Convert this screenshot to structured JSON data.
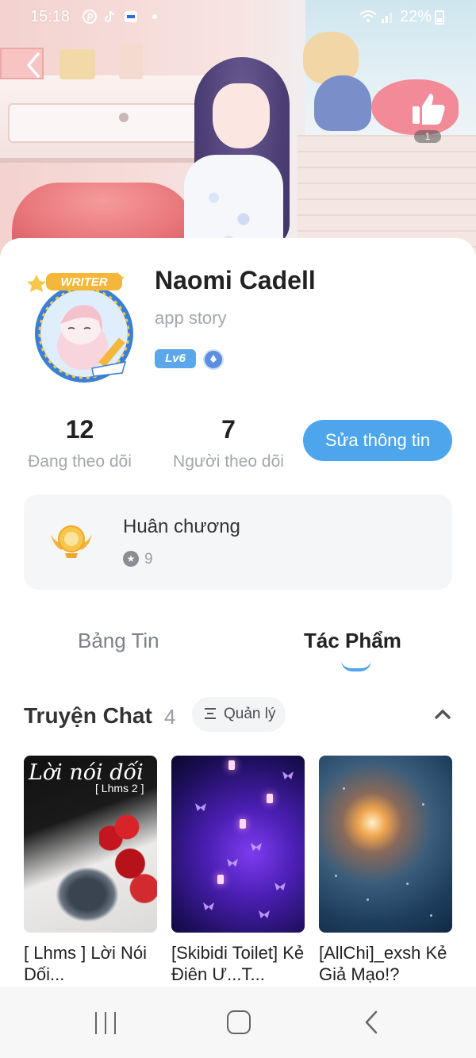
{
  "status_bar": {
    "time": "15:18",
    "battery": "22%"
  },
  "header": {
    "like_count": "1"
  },
  "profile": {
    "avatar_badge": "WRITER",
    "name": "Naomi Cadell",
    "subtitle": "app story",
    "level": "Lv6"
  },
  "stats": {
    "following_count": "12",
    "following_label": "Đang theo dõi",
    "followers_count": "7",
    "followers_label": "Người theo dõi",
    "edit_button": "Sửa thông tin"
  },
  "medal": {
    "title": "Huân chương",
    "count": "9"
  },
  "tabs": [
    {
      "label": "Bảng Tin",
      "active": false
    },
    {
      "label": "Tác Phẩm",
      "active": true
    }
  ],
  "section": {
    "title": "Truyện Chat",
    "count": "4",
    "manage_label": "Quản lý"
  },
  "stories": [
    {
      "title": "[ Lhms ] Lời Nói Dối...",
      "cover_title": "Lời nói dối",
      "cover_subtitle": "[ Lhms 2 ]"
    },
    {
      "title": "[Skibidi Toilet] Kẻ Điên Ư...T..."
    },
    {
      "title": "[AllChi]_exsh Kẻ Giả Mạo!?"
    }
  ],
  "colors": {
    "accent": "#4da6ec",
    "level_badge": "#5aa7ec"
  }
}
